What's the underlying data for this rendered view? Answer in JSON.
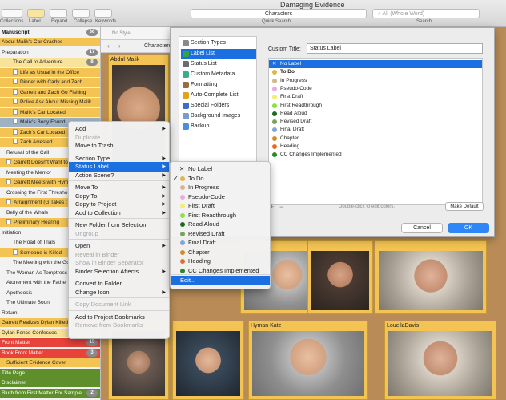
{
  "window": {
    "title": "Damaging Evidence"
  },
  "toolbar": {
    "left_labels": [
      "Collections",
      "Label",
      "Expand",
      "Collapse",
      "Keywords"
    ],
    "quick_search_label": "Characters",
    "quick_search_caption": "Quick Search",
    "search_placeholder": "All (Whole Word)",
    "search_caption": "Search"
  },
  "binder": {
    "header": "Manuscript",
    "header_count": "36",
    "rows": [
      {
        "label": "Abdul Malik's Car Crashes",
        "style": "row-yellow",
        "indent": 0,
        "doc": false
      },
      {
        "label": "Preparation",
        "style": "",
        "indent": 0,
        "doc": false,
        "badge": "17"
      },
      {
        "label": "The Call to Adventure",
        "style": "row-lightyellow",
        "indent": 14,
        "doc": false,
        "badge": "8"
      },
      {
        "label": "Life as Usual in the Office",
        "style": "row-yellow",
        "indent": 14,
        "doc": true
      },
      {
        "label": "Dinner with Carly and Zach",
        "style": "row-yellow",
        "indent": 14,
        "doc": true
      },
      {
        "label": "Garrett and Zach Go Fishing",
        "style": "row-yellow",
        "indent": 14,
        "doc": true
      },
      {
        "label": "Police Ask About Missing Malik",
        "style": "row-yellow",
        "indent": 14,
        "doc": true
      },
      {
        "label": "Malik's Car Located",
        "style": "row-yellow",
        "indent": 14,
        "doc": true
      },
      {
        "label": "Malik's Body Found",
        "style": "row-sel",
        "indent": 14,
        "doc": true
      },
      {
        "label": "Zach's Car Located",
        "style": "row-yellow",
        "indent": 14,
        "doc": true
      },
      {
        "label": "Zach Arrested",
        "style": "row-yellow",
        "indent": 14,
        "doc": true
      },
      {
        "label": "Refusal of the Call",
        "style": "",
        "indent": 6,
        "doc": false
      },
      {
        "label": "Garrett Doesn't Want to Ke",
        "style": "row-yellow",
        "indent": 6,
        "doc": true
      },
      {
        "label": "Meeting the Mentor",
        "style": "",
        "indent": 6,
        "doc": false
      },
      {
        "label": "Garrett Meets with Hym",
        "style": "row-yellow",
        "indent": 6,
        "doc": true
      },
      {
        "label": "Crossing the First Thresho",
        "style": "",
        "indent": 6,
        "doc": false
      },
      {
        "label": "Arraignment (G Takes t",
        "style": "row-yellow",
        "indent": 6,
        "doc": true
      },
      {
        "label": "Belly of the Whale",
        "style": "",
        "indent": 6,
        "doc": false
      },
      {
        "label": "Preliminary Hearing",
        "style": "row-yellow",
        "indent": 6,
        "doc": true
      },
      {
        "label": "Initiation",
        "style": "",
        "indent": 0,
        "doc": false
      },
      {
        "label": "The Road of Trials",
        "style": "",
        "indent": 14,
        "doc": false
      },
      {
        "label": "Someone is Killed",
        "style": "row-yellow",
        "indent": 14,
        "doc": true
      },
      {
        "label": "The Meeting with the God",
        "style": "",
        "indent": 14,
        "doc": false
      },
      {
        "label": "The Woman As Temptress",
        "style": "",
        "indent": 6,
        "doc": false
      },
      {
        "label": "Atonement with the Fathe",
        "style": "",
        "indent": 6,
        "doc": false
      },
      {
        "label": "Apotheosis",
        "style": "",
        "indent": 6,
        "doc": false
      },
      {
        "label": "The Ultimate Boon",
        "style": "",
        "indent": 6,
        "doc": false
      },
      {
        "label": "Return",
        "style": "",
        "indent": 0,
        "doc": false
      },
      {
        "label": "Garrett Realizes Dylan Killed",
        "style": "row-yellow",
        "indent": 0,
        "doc": false
      },
      {
        "label": "Dylan Fence Confesses",
        "style": "row-lightyellow",
        "indent": 0,
        "doc": false
      },
      {
        "label": "Front Matter",
        "style": "row-red",
        "indent": 0,
        "doc": false,
        "badge": "15"
      },
      {
        "label": "Book Front Matter",
        "style": "row-red",
        "indent": 0,
        "doc": false,
        "badge": "3"
      },
      {
        "label": "Sufficient Evidence Cover",
        "style": "row-yellow",
        "indent": 6,
        "doc": false
      },
      {
        "label": "Title Page",
        "style": "row-green",
        "indent": 0,
        "doc": false
      },
      {
        "label": "Disclaimer",
        "style": "row-green",
        "indent": 0,
        "doc": false
      },
      {
        "label": "Blurb from First Matter For Sample",
        "style": "row-green",
        "indent": 0,
        "doc": false,
        "badge": "2"
      }
    ]
  },
  "corkboard": {
    "style_placeholder": "No Style",
    "breadcrumb": "Characters",
    "cards": [
      {
        "name": "Abdul Malik",
        "face": "f1"
      },
      {
        "name": "",
        "face": "f2"
      },
      {
        "name": "",
        "face": "f3"
      },
      {
        "name": "",
        "face": "f5"
      },
      {
        "name": "",
        "face": "f6"
      },
      {
        "name": "",
        "face": "f4"
      },
      {
        "name": "Hyman Katz",
        "face": "f2"
      },
      {
        "name": "LouellaDavis",
        "face": "f5"
      }
    ]
  },
  "inspector": {
    "nav": [
      {
        "label": "Section Types",
        "color": "#8a8a8a"
      },
      {
        "label": "Label List",
        "color": "#37a43a"
      },
      {
        "label": "Status List",
        "color": "#6b6b6b"
      },
      {
        "label": "Custom Metadata",
        "color": "#3bab8b"
      },
      {
        "label": "Formatting",
        "color": "#9a6b3c"
      },
      {
        "label": "Auto-Complete List",
        "color": "#e3a21a"
      },
      {
        "label": "Special Folders",
        "color": "#3a6fc9"
      },
      {
        "label": "Background Images",
        "color": "#7a9ad0"
      },
      {
        "label": "Backup",
        "color": "#4a8fd8"
      }
    ],
    "custom_title_label": "Custom Title:",
    "custom_title_value": "Status Label",
    "labels": [
      {
        "name": "No Label",
        "color": "",
        "bold": false,
        "selected": true
      },
      {
        "name": "To Do",
        "color": "#e0b649",
        "bold": true,
        "selected": false
      },
      {
        "name": "In Progress",
        "color": "#d9b48a",
        "bold": false,
        "selected": false
      },
      {
        "name": "Pseudo-Code",
        "color": "#f0a8e0",
        "bold": false,
        "selected": false
      },
      {
        "name": "First Draft",
        "color": "#f2ef6a",
        "bold": false,
        "selected": false
      },
      {
        "name": "First Readthrough",
        "color": "#8ce23a",
        "bold": false,
        "selected": false
      },
      {
        "name": "Read Aloud",
        "color": "#1f6a1f",
        "bold": false,
        "selected": false
      },
      {
        "name": "Revised Draft",
        "color": "#7aa35a",
        "bold": false,
        "selected": false
      },
      {
        "name": "Final Draft",
        "color": "#7fa6d8",
        "bold": false,
        "selected": false
      },
      {
        "name": "Chapter",
        "color": "#d28b2a",
        "bold": false,
        "selected": false
      },
      {
        "name": "Heading",
        "color": "#e26d2a",
        "bold": false,
        "selected": false
      },
      {
        "name": "CC Changes Implemented",
        "color": "#2a8a2a",
        "bold": false,
        "selected": false
      }
    ],
    "add_symbol": "+",
    "remove_symbol": "−",
    "hint": "Double-click to edit colors.",
    "make_default": "Make Default",
    "cancel": "Cancel",
    "ok": "OK"
  },
  "context_menu": {
    "items": [
      {
        "label": "Add",
        "submenu": true,
        "disabled": false
      },
      {
        "label": "Duplicate",
        "submenu": false,
        "disabled": true
      },
      {
        "label": "Move to Trash",
        "submenu": false,
        "disabled": false
      },
      {
        "sep": true
      },
      {
        "label": "Section Type",
        "submenu": true,
        "disabled": false
      },
      {
        "label": "Status Label",
        "submenu": true,
        "disabled": false,
        "highlight": true
      },
      {
        "label": "Action Scene?",
        "submenu": true,
        "disabled": false
      },
      {
        "sep": true
      },
      {
        "label": "Move To",
        "submenu": true,
        "disabled": false
      },
      {
        "label": "Copy To",
        "submenu": true,
        "disabled": false
      },
      {
        "label": "Copy to Project",
        "submenu": true,
        "disabled": false
      },
      {
        "label": "Add to Collection",
        "submenu": true,
        "disabled": false
      },
      {
        "sep": true
      },
      {
        "label": "New Folder from Selection",
        "submenu": false,
        "disabled": false
      },
      {
        "label": "Ungroup",
        "submenu": false,
        "disabled": true
      },
      {
        "sep": true
      },
      {
        "label": "Open",
        "submenu": true,
        "disabled": false
      },
      {
        "label": "Reveal in Binder",
        "submenu": false,
        "disabled": true
      },
      {
        "label": "Show in Binder Separator",
        "submenu": false,
        "disabled": true
      },
      {
        "label": "Binder Selection Affects",
        "submenu": true,
        "disabled": false
      },
      {
        "sep": true
      },
      {
        "label": "Convert to Folder",
        "submenu": false,
        "disabled": false
      },
      {
        "label": "Change Icon",
        "submenu": true,
        "disabled": false
      },
      {
        "sep": true
      },
      {
        "label": "Copy Document Link",
        "submenu": false,
        "disabled": true
      },
      {
        "sep": true
      },
      {
        "label": "Add to Project Bookmarks",
        "submenu": false,
        "disabled": false
      },
      {
        "label": "Remove from Bookmarks",
        "submenu": false,
        "disabled": true
      }
    ]
  },
  "status_submenu": {
    "items": [
      {
        "label": "No Label",
        "color": "",
        "checked": false,
        "mark": "✕"
      },
      {
        "label": "To Do",
        "color": "#e0b649",
        "checked": true
      },
      {
        "label": "In Progress",
        "color": "#d9b48a",
        "checked": false
      },
      {
        "label": "Pseudo-Code",
        "color": "#f0a8e0",
        "checked": false
      },
      {
        "label": "First Draft",
        "color": "#f2ef6a",
        "checked": false
      },
      {
        "label": "First Readthrough",
        "color": "#8ce23a",
        "checked": false
      },
      {
        "label": "Read Aloud",
        "color": "#1f6a1f",
        "checked": false
      },
      {
        "label": "Revised Draft",
        "color": "#7aa35a",
        "checked": false
      },
      {
        "label": "Final Draft",
        "color": "#7fa6d8",
        "checked": false
      },
      {
        "label": "Chapter",
        "color": "#d28b2a",
        "checked": false
      },
      {
        "label": "Heading",
        "color": "#e26d2a",
        "checked": false
      },
      {
        "label": "CC Changes Implemented",
        "color": "#2a8a2a",
        "checked": false
      },
      {
        "label": "Edit...",
        "color": "",
        "checked": false,
        "edit": true
      }
    ]
  }
}
